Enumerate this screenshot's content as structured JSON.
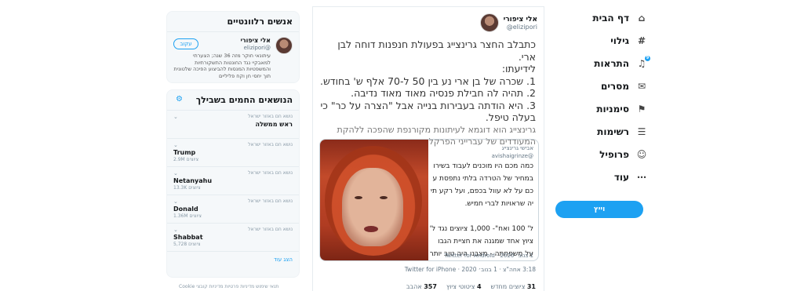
{
  "nav": {
    "items": [
      {
        "label": "דף הבית",
        "icon": "home-icon",
        "glyph": "⌂"
      },
      {
        "label": "גילוי",
        "icon": "hashtag-icon",
        "glyph": "#"
      },
      {
        "label": "התראות",
        "icon": "bell-icon",
        "glyph": "♫",
        "badge": "9"
      },
      {
        "label": "מסרים",
        "icon": "envelope-icon",
        "glyph": "✉"
      },
      {
        "label": "סימניות",
        "icon": "bookmark-icon",
        "glyph": "⚑"
      },
      {
        "label": "רשימות",
        "icon": "list-icon",
        "glyph": "☰"
      },
      {
        "label": "פרופיל",
        "icon": "person-icon",
        "glyph": "☺"
      },
      {
        "label": "עוד",
        "icon": "more-icon",
        "glyph": "⋯"
      }
    ],
    "tweet_button": "וייץ"
  },
  "tweet": {
    "author_name": "אלי ציפורי",
    "author_handle": "@elizipori",
    "body_lines": [
      "כתבלב החצר גרינצייג בפעולת חנפנות דוחה לבן ארי.",
      "לידיעתו:",
      "1. שכרה של בן ארי נע בין 50 ל-70 אלף ש' בחודש.",
      "2. תהיה לה חבילת פנסיה מאוד מאוד נדיבה.",
      "3. היא הודתה בעבירות בנייה אבל \"הצרה על כר\" כי",
      "בעלה טיפל."
    ],
    "body_dim_lines": [
      "גרינצייג הוא דוגמא לעיתונות מקורנפת שהפכה ללהקת",
      "המעודדים של עברייני הפרקליטות"
    ],
    "quote": {
      "header_name": "אבישי גרינצייג",
      "header_handle": "@avishaigrinze",
      "lines": [
        "כמה מכם היו מוכנים לעבוד בשירו",
        "במחיר של הטרדה בלתי נתפסת ע",
        "כם על לא עוול בכפם, ועל רקע תיא",
        "יה שראויות לברי חמיש.",
        "",
        "ל' 100 ואח\"- 1,000 ציוצים נגד ל'א",
        "ציוץ אחד שמגנה את חציית הגבו",
        "על משפחתה - מצבנו היה טוב יותר"
      ],
      "footer": "1 בנוב׳ 2020 · Twitter for Android"
    },
    "meta": "3:18 אחה\"צ · 1 בנוב׳ 2020 · Twitter for iPhone",
    "stats": [
      {
        "count": "31",
        "label": "ציוצים מחדש"
      },
      {
        "count": "4",
        "label": "ציטוטי ציוץ"
      },
      {
        "count": "357",
        "label": "אהבב"
      }
    ]
  },
  "relevant": {
    "title": "אנשים רלוונטיים",
    "name": "אלי ציפורי",
    "handle": "@elizipori",
    "follow_label": "עקוב",
    "bio": "עיתונאי חוקר מזה 36 שנה; הצערתי למאבקיי נגד החונטות התשקורתיות והמשפטיות המנסות להביצוע הפיכה שלטונית תוך יחסי חן וקח פליליים"
  },
  "trends": {
    "title": "הנושאים החמים בשבילך",
    "items": [
      {
        "context": "נושא חם באזור ישראל",
        "name": "ראש ממשלה",
        "count": "",
        "en": false
      },
      {
        "context": "נושא חם באזור ישראל",
        "name": "Trump",
        "count": "2.9M ציוצים",
        "en": true
      },
      {
        "context": "נושא חם באזור ישראל",
        "name": "Netanyahu",
        "count": "13.3K ציוצים",
        "en": true
      },
      {
        "context": "נושא חם באזור ישראל",
        "name": "Donald",
        "count": "1.36M ציוצים",
        "en": true
      },
      {
        "context": "נושא חם באזור ישראל",
        "name": "Shabbat",
        "count": "5,728 ציוצים",
        "en": true
      }
    ],
    "more": "הצג עוד"
  },
  "footer": "תנאי שימוש  מדיניות פרטיות  מדיניות קובצי Cookie"
}
